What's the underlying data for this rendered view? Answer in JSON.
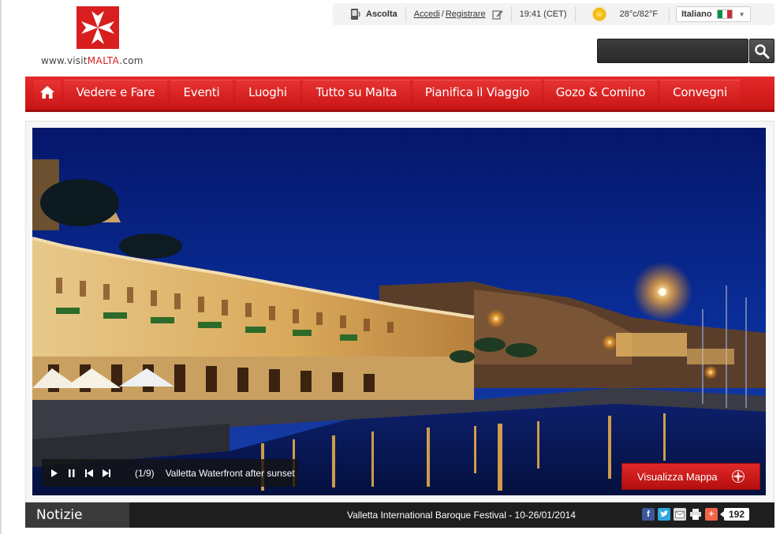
{
  "logo": {
    "prefix": "www.visit",
    "brand": "MALTA",
    "suffix": ".com",
    "color": "#d81e1e"
  },
  "topbar": {
    "listen_label": "Ascolta",
    "login_label": "Accedi",
    "separator": "/",
    "register_label": "Registrare",
    "time": "19:41 (CET)",
    "weather_icon": "sun-icon",
    "temperature": "28°c/82°F",
    "language": "Italiano",
    "language_flag": "italy-flag"
  },
  "search": {
    "placeholder": "",
    "button_icon": "search-icon"
  },
  "nav": {
    "home_icon": "home-icon",
    "items": [
      {
        "label": "Vedere e Fare"
      },
      {
        "label": "Eventi"
      },
      {
        "label": "Luoghi"
      },
      {
        "label": "Tutto su Malta"
      },
      {
        "label": "Pianifica il Viaggio"
      },
      {
        "label": "Gozo & Comino"
      },
      {
        "label": "Convegni"
      }
    ],
    "color": "#d81e1e"
  },
  "slideshow": {
    "counter": "(1/9)",
    "caption": "Valletta Waterfront after sunset",
    "controls": [
      "play-icon",
      "pause-icon",
      "previous-icon",
      "next-icon"
    ],
    "map_button": "Visualizza Mappa"
  },
  "news": {
    "label": "Notizie",
    "headline": "Valletta International Baroque Festival - 10-26/01/2014",
    "share_icons": [
      "facebook-icon",
      "twitter-icon",
      "email-icon",
      "print-icon",
      "addthis-icon"
    ],
    "share_count": "192"
  }
}
